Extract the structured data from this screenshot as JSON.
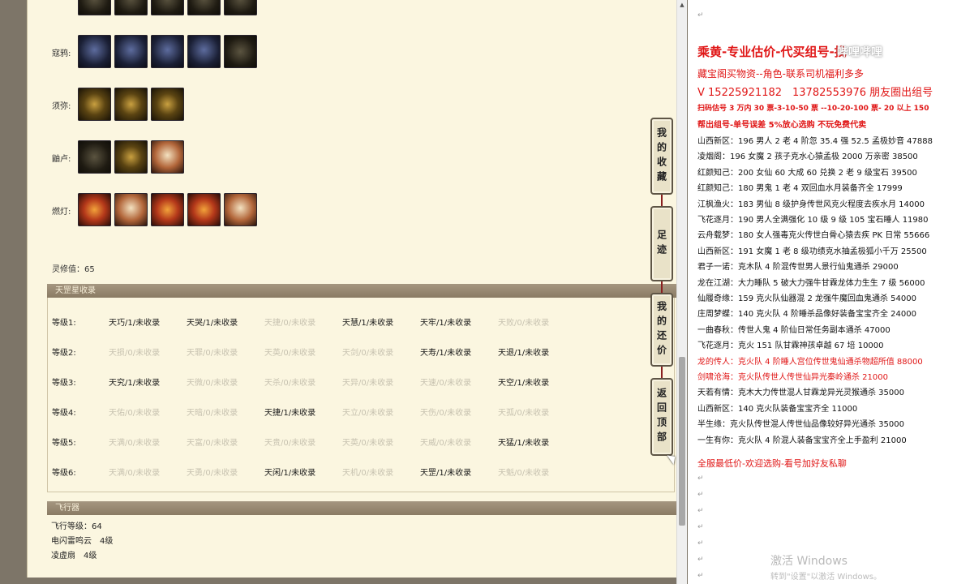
{
  "equipment": {
    "rows": [
      {
        "label": "",
        "icons": [
          "dark-equipment-icon",
          "dark-equipment-icon",
          "dark-equipment-icon",
          "dark-equipment-icon",
          "dark-equipment-icon"
        ]
      },
      {
        "label": "寇鸦:",
        "icons": [
          "blue-blade-icon",
          "blue-armor-icon",
          "blue-sword-icon",
          "blue-ring-icon",
          "dark-armor-icon"
        ]
      },
      {
        "label": "须弥:",
        "icons": [
          "gold-whip-icon",
          "gold-ring-icon",
          "gold-pendant-icon"
        ]
      },
      {
        "label": "鼬卢:",
        "icons": [
          "dark-necklace-icon",
          "gold-orb-icon",
          "cream-robe-icon"
        ]
      },
      {
        "label": "燃灯:",
        "icons": [
          "fire-crown-icon",
          "cream-robe-icon",
          "fire-helm-icon",
          "fire-orb-icon",
          "cream-hat-icon"
        ]
      }
    ],
    "spirit_value": "灵修值：65"
  },
  "tianming": {
    "header": "天罡星收录",
    "rows": [
      {
        "level": "等级1:",
        "cells": [
          {
            "t": "天巧/1/未收录",
            "on": true
          },
          {
            "t": "天哭/1/未收录",
            "on": true
          },
          {
            "t": "天捷/0/未收录",
            "on": false
          },
          {
            "t": "天慧/1/未收录",
            "on": true
          },
          {
            "t": "天牢/1/未收录",
            "on": true
          },
          {
            "t": "天败/0/未收录",
            "on": false
          }
        ]
      },
      {
        "level": "等级2:",
        "cells": [
          {
            "t": "天损/0/未收录",
            "on": false
          },
          {
            "t": "天罪/0/未收录",
            "on": false
          },
          {
            "t": "天英/0/未收录",
            "on": false
          },
          {
            "t": "天剑/0/未收录",
            "on": false
          },
          {
            "t": "天寿/1/未收录",
            "on": true
          },
          {
            "t": "天退/1/未收录",
            "on": true
          }
        ]
      },
      {
        "level": "等级3:",
        "cells": [
          {
            "t": "天究/1/未收录",
            "on": true
          },
          {
            "t": "天微/0/未收录",
            "on": false
          },
          {
            "t": "天杀/0/未收录",
            "on": false
          },
          {
            "t": "天异/0/未收录",
            "on": false
          },
          {
            "t": "天速/0/未收录",
            "on": false
          },
          {
            "t": "天空/1/未收录",
            "on": true
          }
        ]
      },
      {
        "level": "等级4:",
        "cells": [
          {
            "t": "天佑/0/未收录",
            "on": false
          },
          {
            "t": "天暗/0/未收录",
            "on": false
          },
          {
            "t": "天捷/1/未收录",
            "on": true
          },
          {
            "t": "天立/0/未收录",
            "on": false
          },
          {
            "t": "天伤/0/未收录",
            "on": false
          },
          {
            "t": "天孤/0/未收录",
            "on": false
          }
        ]
      },
      {
        "level": "等级5:",
        "cells": [
          {
            "t": "天满/0/未收录",
            "on": false
          },
          {
            "t": "天富/0/未收录",
            "on": false
          },
          {
            "t": "天贵/0/未收录",
            "on": false
          },
          {
            "t": "天英/0/未收录",
            "on": false
          },
          {
            "t": "天威/0/未收录",
            "on": false
          },
          {
            "t": "天猛/1/未收录",
            "on": true
          }
        ]
      },
      {
        "level": "等级6:",
        "cells": [
          {
            "t": "天满/0/未收录",
            "on": false
          },
          {
            "t": "天勇/0/未收录",
            "on": false
          },
          {
            "t": "天闲/1/未收录",
            "on": true
          },
          {
            "t": "天机/0/未收录",
            "on": false
          },
          {
            "t": "天罡/1/未收录",
            "on": true
          },
          {
            "t": "天魁/0/未收录",
            "on": false
          }
        ]
      }
    ]
  },
  "flying": {
    "header": "飞行器",
    "lines": [
      "飞行等级：64",
      "电闪雷鸣云　4级",
      "凌虚扇　4级"
    ]
  },
  "side_tabs": [
    "我的收藏",
    "足迹",
    "我的还价",
    "返回顶部"
  ],
  "doc": {
    "title": "乘黄-专业估价-代买组号-找",
    "watermark": "哔哩哔哩",
    "shop": "藏宝阁买物资--角色-联系司机福利多多",
    "vx": "V 15225921182　13782553976 朋友圈出组号",
    "price_line": "扫码估号 3 万内 30 票-3-10-50 票 --10-20-100 票- 20 以上 150",
    "help_line": "帮出组号-单号误差 5%放心选购 不玩免费代卖",
    "listings": [
      {
        "text": "山西新区：196 男人 2 老 4 阶忽 35.4 强 52.5 孟极妙音 47888",
        "red": false
      },
      {
        "text": "凌烟阁：196 女魔 2 孩子克水心猿孟极 2000 万亲密 38500",
        "red": false
      },
      {
        "text": "红颜知己：200 女仙 60 大成 60 兑换 2 老 9 级宝石 39500",
        "red": false
      },
      {
        "text": "红颜知己：180 男鬼 1 老 4 双回血水月装备齐全 17999",
        "red": false
      },
      {
        "text": "江枫渔火：183 男仙 8 级护身传世风克火程度去疾水月 14000",
        "red": false
      },
      {
        "text": "飞花逐月：190 男人全满强化 10 级 9 级 105 宝石睡人 11980",
        "red": false
      },
      {
        "text": "云舟载梦：180 女人强毒克火传世白骨心猿去疾 PK 日常 55666",
        "red": false
      },
      {
        "text": "山西新区：191 女魔 1 老 8 级功绩克水抽孟极狐小千万 25500",
        "red": false
      },
      {
        "text": "君子一诺：克木队 4 阶混传世男人景行仙鬼通杀 29000",
        "red": false
      },
      {
        "text": "龙在江湖：大力睡队 5 破大力强牛甘霖龙体力生生 7 级 56000",
        "red": false
      },
      {
        "text": "仙履奇缘：159 克火队仙器混 2 龙强牛魔回血鬼通杀 54000",
        "red": false
      },
      {
        "text": "庄周梦蝶：140 克火队 4 阶睡杀品像好装备宝宝齐全 24000",
        "red": false
      },
      {
        "text": "一曲春秋：传世人鬼 4 阶仙日常任务副本通杀 47000",
        "red": false
      },
      {
        "text": "飞花逐月：克火 151 队甘霖神孩卓越 67 培 10000",
        "red": false
      },
      {
        "text": "龙的传人：克火队 4 阶睡人宫位传世鬼仙通杀物超所值 88000",
        "red": true
      },
      {
        "text": "剑啸沧海：克火队传世人传世仙异光秦岭通杀 21000",
        "red": true
      },
      {
        "text": "天若有情：克木大力传世混人甘霖龙异光灵猴通杀 35000",
        "red": false
      },
      {
        "text": "山西新区：140 克火队装备宝宝齐全 11000",
        "red": false
      },
      {
        "text": "半生缘：克火队传世混人传世仙品像较好异光通杀 35000",
        "red": false
      },
      {
        "text": "一生有你：克火队 4 阶混人装备宝宝齐全上手盈利 21000",
        "red": false
      }
    ],
    "footer": "全服最低价-欢迎选购-看号加好友私聊",
    "para_mark": "↵",
    "windows_activate": "激活 Windows",
    "windows_activate_sub": "转到\"设置\"以激活 Windows。"
  }
}
